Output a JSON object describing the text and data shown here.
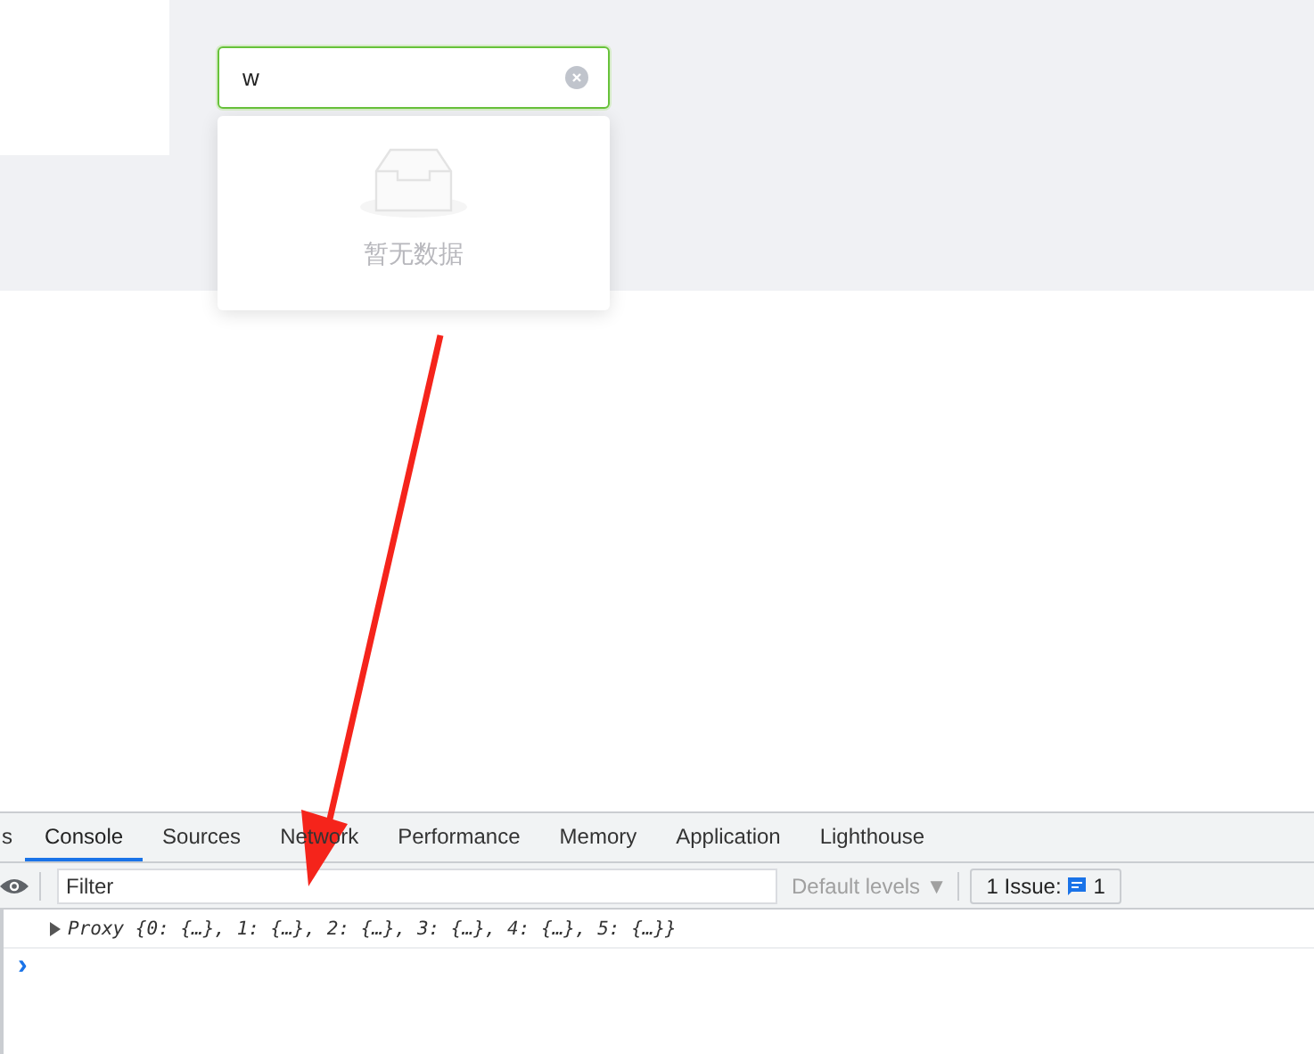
{
  "search": {
    "value": "w",
    "clearable": true,
    "focused": true
  },
  "dropdown": {
    "empty_text": "暂无数据"
  },
  "devtools": {
    "tabs": [
      {
        "label": "s",
        "selected": false
      },
      {
        "label": "Console",
        "selected": true
      },
      {
        "label": "Sources",
        "selected": false
      },
      {
        "label": "Network",
        "selected": false
      },
      {
        "label": "Performance",
        "selected": false
      },
      {
        "label": "Memory",
        "selected": false
      },
      {
        "label": "Application",
        "selected": false
      },
      {
        "label": "Lighthouse",
        "selected": false
      }
    ],
    "filter": {
      "placeholder": "Filter"
    },
    "levels": {
      "label": "Default levels ▼"
    },
    "issues": {
      "label": "1 Issue:",
      "count": "1"
    },
    "log": [
      {
        "text": "Proxy {0: {…}, 1: {…}, 2: {…}, 3: {…}, 4: {…}, 5: {…}}",
        "expanded": false
      }
    ],
    "prompt": "›"
  }
}
